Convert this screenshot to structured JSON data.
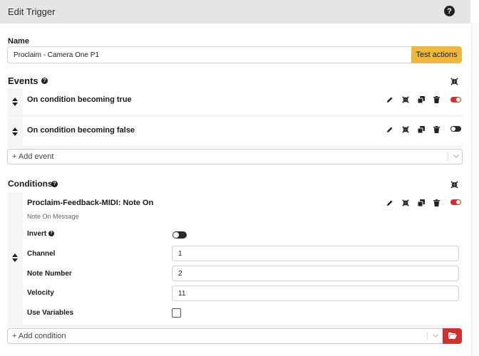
{
  "header": {
    "title": "Edit Trigger",
    "help_glyph": "?"
  },
  "name_section": {
    "label": "Name",
    "value": "Proclaim - Camera One P1",
    "test_button": "Test actions"
  },
  "events": {
    "heading": "Events",
    "help_glyph": "?",
    "items": [
      {
        "title": "On condition becoming true",
        "enabled": true
      },
      {
        "title": "On condition becoming false",
        "enabled": false
      }
    ],
    "add_label": "+ Add event"
  },
  "conditions": {
    "heading": "Conditions",
    "help_glyph": "?",
    "item": {
      "title": "Proclaim-Feedback-MIDI: Note On",
      "subtitle": "Note On Message",
      "enabled": true,
      "fields": [
        {
          "label": "Invert",
          "type": "toggle",
          "value": false
        },
        {
          "label": "Channel",
          "type": "text",
          "value": "1"
        },
        {
          "label": "Note Number",
          "type": "text",
          "value": "2"
        },
        {
          "label": "Velocity",
          "type": "text",
          "value": "11"
        },
        {
          "label": "Use Variables",
          "type": "checkbox",
          "value": false
        }
      ]
    },
    "add_label": "+ Add condition"
  },
  "colors": {
    "accent_red": "#d2302c",
    "test_button": "#f0b73e",
    "toggle_off": "#2a2a2a"
  },
  "icons": {
    "edit": "pencil-icon",
    "collapse": "compress-icon",
    "duplicate": "copy-icon",
    "delete": "trash-icon",
    "reorder": "sort-icon",
    "folder": "folder-open-icon"
  }
}
